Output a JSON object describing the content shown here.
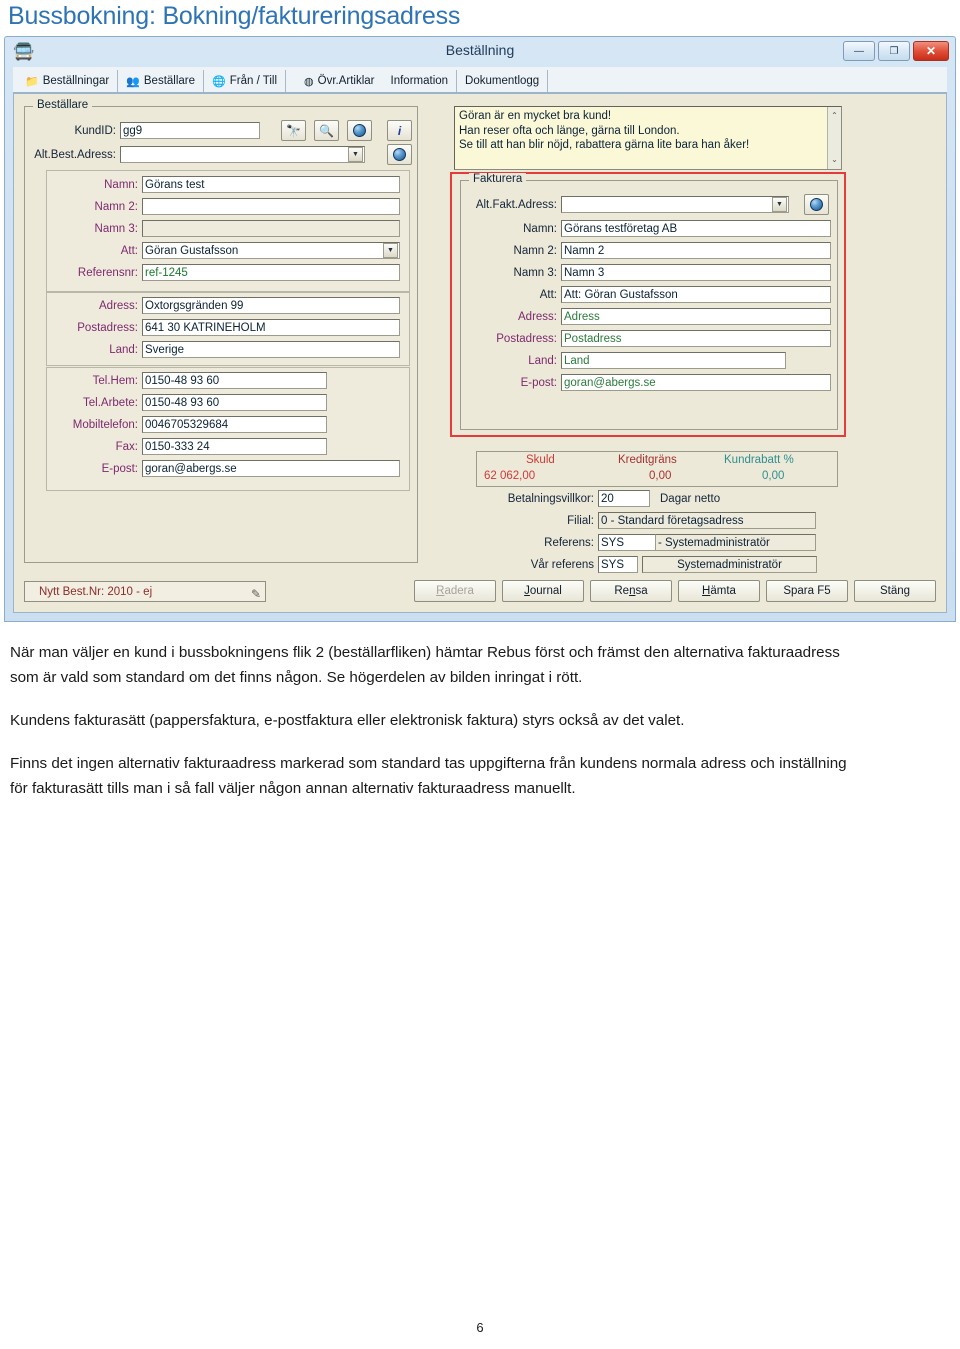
{
  "document": {
    "title": "Bussbokning: Bokning/faktureringsadress",
    "page_number": "6",
    "paragraphs": [
      "När man väljer en kund i bussbokningens flik 2 (beställarfliken) hämtar Rebus först och främst den alternativa fakturaadress som är vald som standard om det finns någon. Se högerdelen av bilden inringat i rött.",
      "Kundens fakturasätt (pappersfaktura, e-postfaktura eller elektronisk faktura) styrs också av det valet.",
      "Finns det ingen alternativ fakturaadress markerad som standard tas uppgifterna från kundens normala adress och inställning för fakturasätt tills man i så fall väljer någon annan alternativ fakturaadress manuellt."
    ]
  },
  "window": {
    "title": "Beställning",
    "app_icon": "bus-icon",
    "buttons": {
      "minimize": "—",
      "maximize": "❐",
      "close": "✕"
    },
    "tabs": [
      {
        "label": "Beställningar",
        "icon": "folder-icon"
      },
      {
        "label": "Beställare",
        "icon": "people-icon"
      },
      {
        "label": "Från / Till",
        "icon": "globe-icon"
      },
      {
        "label": "Övr.Artiklar",
        "icon": "circle-icon"
      },
      {
        "label": "Information",
        "icon": ""
      },
      {
        "label": "Dokumentlogg",
        "icon": ""
      }
    ]
  },
  "left_panel": {
    "legend": "Beställare",
    "kundid": {
      "label": "KundID:",
      "value": "gg9"
    },
    "kundid_buttons": [
      {
        "name": "binoculars-icon",
        "glyph": "🔍"
      },
      {
        "name": "zoom-in-icon",
        "glyph": "⊕"
      },
      {
        "name": "globe-icon",
        "glyph": ""
      },
      {
        "name": "info-icon",
        "glyph": "i"
      }
    ],
    "alt_best_adress": {
      "label": "Alt.Best.Adress:",
      "value": ""
    },
    "name_block": [
      {
        "label": "Namn:",
        "value": "Görans test"
      },
      {
        "label": "Namn 2:",
        "value": ""
      },
      {
        "label": "Namn 3:",
        "value": ""
      }
    ],
    "att": {
      "label": "Att:",
      "value": "Göran Gustafsson"
    },
    "referensnr": {
      "label": "Referensnr:",
      "value": "ref-1245"
    },
    "address_block": [
      {
        "label": "Adress:",
        "value": "Oxtorgsgränden 99"
      },
      {
        "label": "Postadress:",
        "value": "641 30  KATRINEHOLM"
      },
      {
        "label": "Land:",
        "value": "Sverige"
      }
    ],
    "contact_block": [
      {
        "label": "Tel.Hem:",
        "value": "0150-48 93 60"
      },
      {
        "label": "Tel.Arbete:",
        "value": "0150-48 93 60"
      },
      {
        "label": "Mobiltelefon:",
        "value": "0046705329684"
      },
      {
        "label": "Fax:",
        "value": "0150-333 24"
      },
      {
        "label": "E-post:",
        "value": "goran@abergs.se"
      }
    ]
  },
  "right_panel": {
    "memo": {
      "lines": [
        "Göran är en mycket bra kund!",
        "Han reser ofta och länge, gärna till London.",
        "Se till att han blir nöjd, rabattera gärna lite bara han åker!"
      ],
      "scroll_up": "⌃",
      "scroll_down": "⌄"
    },
    "fakturera": {
      "legend": "Fakturera",
      "highlight_color": "#e43b3b",
      "alt_fakt_adress": {
        "label": "Alt.Fakt.Adress:",
        "value": ""
      },
      "fields": [
        {
          "label": "Namn:",
          "value": "Görans testföretag AB"
        },
        {
          "label": "Namn 2:",
          "value": "Namn 2"
        },
        {
          "label": "Namn 3:",
          "value": "Namn 3"
        },
        {
          "label": "Att:",
          "value": "Att: Göran Gustafsson"
        },
        {
          "label": "Adress:",
          "value": "Adress"
        },
        {
          "label": "Postadress:",
          "value": "Postadress"
        },
        {
          "label": "Land:",
          "value": "Land"
        },
        {
          "label": "E-post:",
          "value": "goran@abergs.se"
        }
      ]
    },
    "financial": {
      "headers": [
        {
          "label": "Skuld",
          "color": "#cf3a3a"
        },
        {
          "label": "Kreditgräns",
          "color": "#a63232"
        },
        {
          "label": "Kundrabatt %",
          "color": "#2f8f8f"
        }
      ],
      "values": [
        {
          "value": "62 062,00",
          "color": "#cf3a3a"
        },
        {
          "value": "0,00",
          "color": "#a63232"
        },
        {
          "value": "0,00",
          "color": "#2f8f8f"
        }
      ],
      "betalningsvillkor": {
        "label": "Betalningsvillkor:",
        "value": "20",
        "suffix": "Dagar netto"
      },
      "filial": {
        "label": "Filial:",
        "value": "0  - Standard företagsadress"
      },
      "referens": {
        "label": "Referens:",
        "value": "SYS",
        "value2": "- Systemadministratör"
      },
      "var_referens": {
        "label": "Vår referens",
        "value": "SYS",
        "value2": "Systemadministratör"
      }
    }
  },
  "bottom_bar": {
    "best_nr": "Nytt Best.Nr: 2010 - ej",
    "best_nr_icon": "pen-icon",
    "buttons": [
      {
        "label": "Radera",
        "disabled": true
      },
      {
        "label": "Journal",
        "disabled": false
      },
      {
        "label": "Rensa",
        "disabled": false
      },
      {
        "label": "Hämta",
        "disabled": false
      },
      {
        "label": "Spara F5",
        "disabled": false
      },
      {
        "label": "Stäng",
        "disabled": false
      }
    ]
  }
}
